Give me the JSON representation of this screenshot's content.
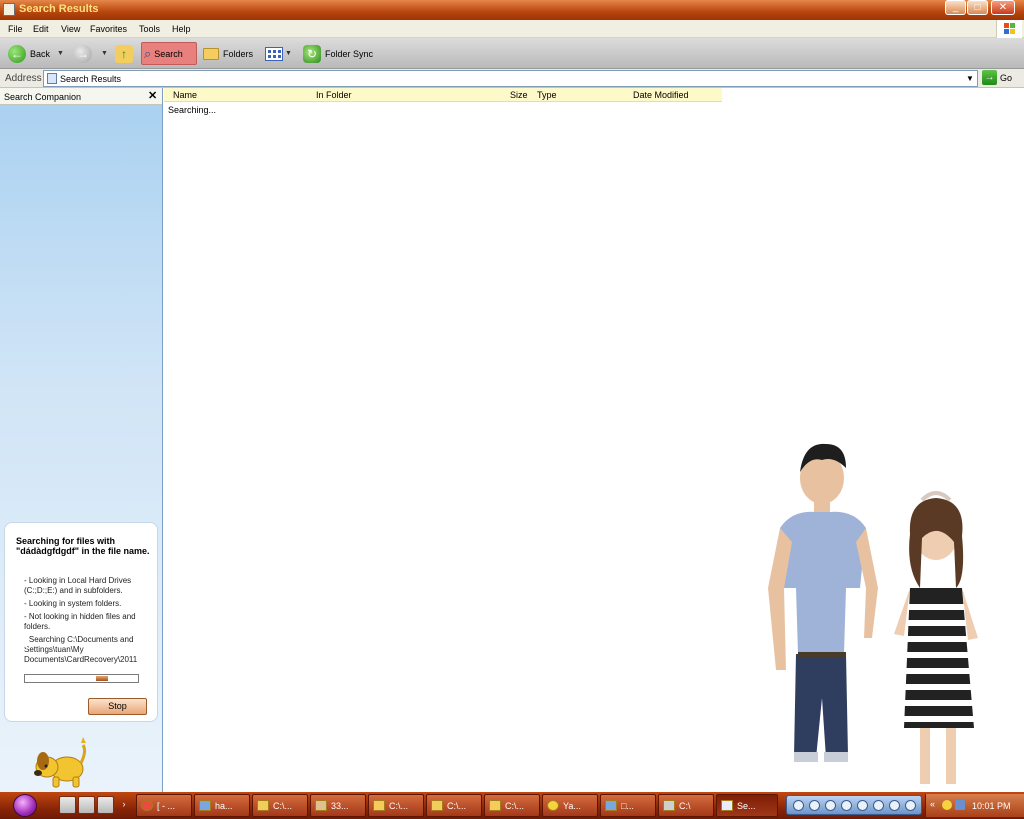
{
  "window": {
    "title": "Search Results"
  },
  "menu": [
    "File",
    "Edit",
    "View",
    "Favorites",
    "Tools",
    "Help"
  ],
  "toolbar": {
    "back": "Back",
    "search": "Search",
    "folders": "Folders",
    "folder_sync": "Folder Sync"
  },
  "address": {
    "label": "Address",
    "value": "Search Results",
    "go": "Go"
  },
  "companion": {
    "title": "Search Companion",
    "close": "✕",
    "heading": "Searching for files with \"dádàdgfdgdf\" in the file name.",
    "notes": [
      "- Looking in Local Hard Drives (C:;D:;E:) and in subfolders.",
      "- Looking in system folders.",
      "- Not looking in hidden files and folders.",
      "- Searching C:\\Documents and Settings\\tuan\\My Documents\\CardRecovery\\2011"
    ],
    "progress": 0.7,
    "stop": "Stop"
  },
  "results": {
    "columns": [
      "Name",
      "In Folder",
      "Size",
      "Type",
      "Date Modified"
    ],
    "status": "Searching..."
  },
  "taskbar": {
    "tasks": [
      "[ - ...",
      "ha...",
      "C:\\...",
      "33...",
      "C:\\...",
      "C:\\...",
      "C:\\...",
      "Ya...",
      "□...",
      "C:\\",
      "Se..."
    ],
    "clock": "10:01 PM"
  }
}
